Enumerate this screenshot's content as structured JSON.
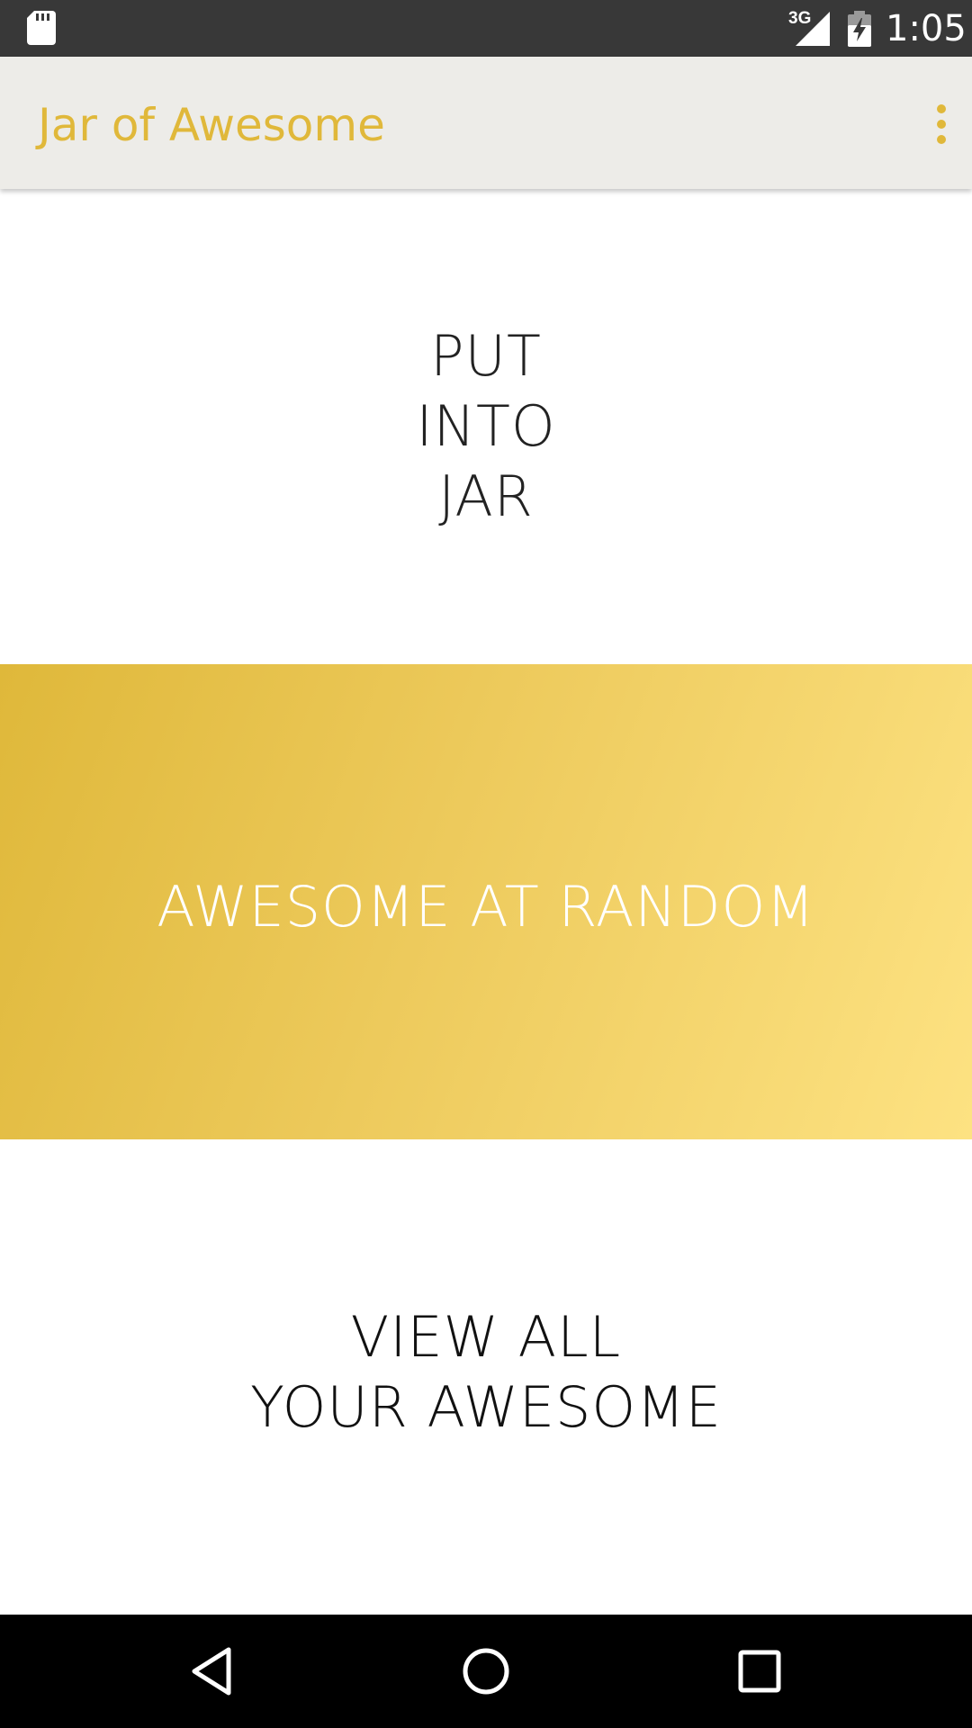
{
  "status_bar": {
    "network_type": "3G",
    "time": "1:05",
    "icons": [
      "sd-card-icon",
      "signal-icon",
      "battery-icon"
    ]
  },
  "app_bar": {
    "title": "Jar of Awesome",
    "overflow_icon": "more-vert-icon"
  },
  "main": {
    "put_into_jar": {
      "lines": [
        "PUT",
        "INTO",
        "JAR"
      ]
    },
    "awesome_at_random": {
      "label": "AWESOME AT RANDOM"
    },
    "view_all": {
      "lines": [
        "VIEW ALL",
        "YOUR AWESOME"
      ]
    }
  },
  "nav_bar": {
    "icons": [
      "back-icon",
      "home-icon",
      "recents-icon"
    ]
  },
  "colors": {
    "accent": "#e0b83a",
    "app_bar_bg": "#edece8",
    "gradient_start": "#dfb83a",
    "gradient_end": "#fde282",
    "status_bar_bg": "#383838",
    "nav_bar_bg": "#000000"
  }
}
